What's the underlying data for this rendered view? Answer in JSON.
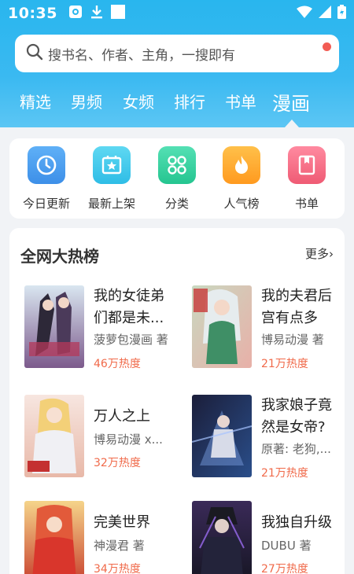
{
  "status_bar": {
    "time": "10:35",
    "icons_left": [
      "camera-icon",
      "download-icon",
      "square-icon"
    ],
    "icons_right": [
      "wifi-icon",
      "signal-icon",
      "battery-icon"
    ]
  },
  "search": {
    "placeholder": "搜书名、作者、主角，一搜即有",
    "has_notification_dot": true
  },
  "tabs": [
    {
      "label": "精选",
      "active": false
    },
    {
      "label": "男频",
      "active": false
    },
    {
      "label": "女频",
      "active": false
    },
    {
      "label": "排行",
      "active": false
    },
    {
      "label": "书单",
      "active": false
    },
    {
      "label": "漫画",
      "active": true
    }
  ],
  "quick_entries": [
    {
      "label": "今日更新",
      "icon": "clock-icon",
      "color": "#4a9cf0"
    },
    {
      "label": "最新上架",
      "icon": "star-box-icon",
      "color": "#3fc6e8"
    },
    {
      "label": "分类",
      "icon": "grid-icon",
      "color": "#35d0a0"
    },
    {
      "label": "人气榜",
      "icon": "flame-icon",
      "color": "#ffa629"
    },
    {
      "label": "书单",
      "icon": "book-icon",
      "color": "#f26b80"
    }
  ],
  "ranking": {
    "title": "全网大热榜",
    "more_label": "更多",
    "books": [
      {
        "title": "我的女徒弟们都是未...",
        "author": "菠萝包漫画 著",
        "heat": "46万热度"
      },
      {
        "title": "我的夫君后宫有点多",
        "author": "博易动漫 著",
        "heat": "21万热度"
      },
      {
        "title": "万人之上",
        "author": "博易动漫 x...",
        "heat": "32万热度"
      },
      {
        "title": "我家娘子竟然是女帝?",
        "author": "原著: 老狗,...",
        "heat": "21万热度"
      },
      {
        "title": "完美世界",
        "author": "神漫君 著",
        "heat": "34万热度"
      },
      {
        "title": "我独自升级",
        "author": "DUBU 著",
        "heat": "27万热度"
      }
    ]
  },
  "colors": {
    "header": "#29b6ee",
    "heat": "#f06a4a",
    "notification_dot": "#f25c54"
  }
}
